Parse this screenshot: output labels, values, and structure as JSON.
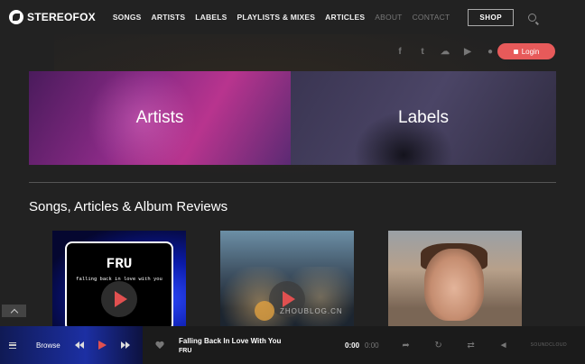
{
  "brand": {
    "name": "STEREOFOX"
  },
  "nav": {
    "items": [
      {
        "label": "SONGS",
        "dim": false
      },
      {
        "label": "ARTISTS",
        "dim": false
      },
      {
        "label": "LABELS",
        "dim": false
      },
      {
        "label": "PLAYLISTS & MIXES",
        "dim": false
      },
      {
        "label": "ARTICLES",
        "dim": false
      },
      {
        "label": "ABOUT",
        "dim": true
      },
      {
        "label": "CONTACT",
        "dim": true
      }
    ],
    "shop_label": "SHOP"
  },
  "social": [
    "facebook-icon",
    "twitter-icon",
    "soundcloud-icon",
    "youtube-icon",
    "spotify-icon"
  ],
  "login": {
    "label": "Login"
  },
  "tiles": {
    "artists": "Artists",
    "labels": "Labels"
  },
  "section": {
    "title": "Songs, Articles & Album Reviews"
  },
  "cards": {
    "fru": {
      "title": "FRU",
      "subtitle": "falling back in love with you"
    }
  },
  "watermark": {
    "text": "ZHOUBLOG.CN"
  },
  "player": {
    "browse_label": "Browse",
    "track_title": "Falling Back In Love With You",
    "track_artist": "FRU",
    "time_current": "0:00",
    "time_total": "0:00",
    "source_label": "SOUNDCLOUD"
  },
  "colors": {
    "accent": "#e75a5a",
    "background": "#222222"
  }
}
